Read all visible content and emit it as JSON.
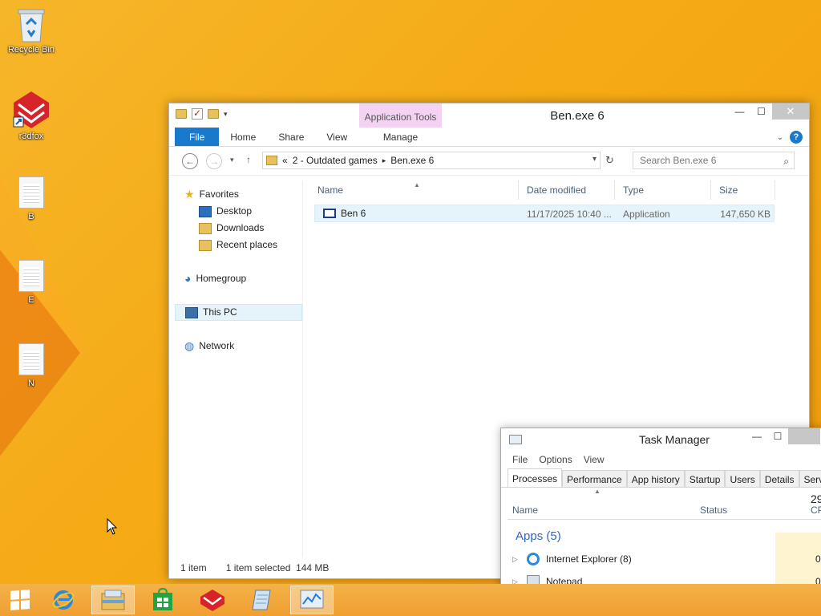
{
  "desktop": {
    "icons": [
      {
        "label": "Recycle Bin"
      },
      {
        "label": "r3dfox"
      },
      {
        "label": "B"
      },
      {
        "label": "E"
      },
      {
        "label": "N"
      }
    ]
  },
  "explorer": {
    "title": "Ben.exe 6",
    "contextual_tab_group": "Application Tools",
    "ribbon_tabs": {
      "file": "File",
      "home": "Home",
      "share": "Share",
      "view": "View",
      "manage": "Manage"
    },
    "address": {
      "prefix": "«",
      "crumb1": "2 - Outdated games",
      "separator": "▸",
      "crumb2": "Ben.exe 6"
    },
    "search_placeholder": "Search Ben.exe 6",
    "nav": {
      "favorites": "Favorites",
      "desktop": "Desktop",
      "downloads": "Downloads",
      "recent": "Recent places",
      "homegroup": "Homegroup",
      "this_pc": "This PC",
      "network": "Network"
    },
    "columns": {
      "name": "Name",
      "date": "Date modified",
      "type": "Type",
      "size": "Size"
    },
    "files": [
      {
        "name": "Ben 6",
        "date": "11/17/2025 10:40 ...",
        "type": "Application",
        "size": "147,650 KB"
      }
    ],
    "status": {
      "count": "1 item",
      "selected": "1 item selected  144 MB"
    }
  },
  "taskmgr": {
    "title": "Task Manager",
    "menu": {
      "file": "File",
      "options": "Options",
      "view": "View"
    },
    "tabs": {
      "processes": "Processes",
      "performance": "Performance",
      "app_history": "App history",
      "startup": "Startup",
      "users": "Users",
      "details": "Details",
      "services": "Servic"
    },
    "headers": {
      "name": "Name",
      "status": "Status",
      "cpu": "CP",
      "cpu_pct": "29"
    },
    "group": "Apps (5)",
    "rows": [
      {
        "name": "Internet Explorer (8)",
        "cpu": "0"
      },
      {
        "name": "Notepad",
        "cpu": "0"
      }
    ]
  },
  "colors": {
    "accent": "#1979ca",
    "wallpaper": "#f5ab17",
    "selection": "#e5f3fb"
  }
}
